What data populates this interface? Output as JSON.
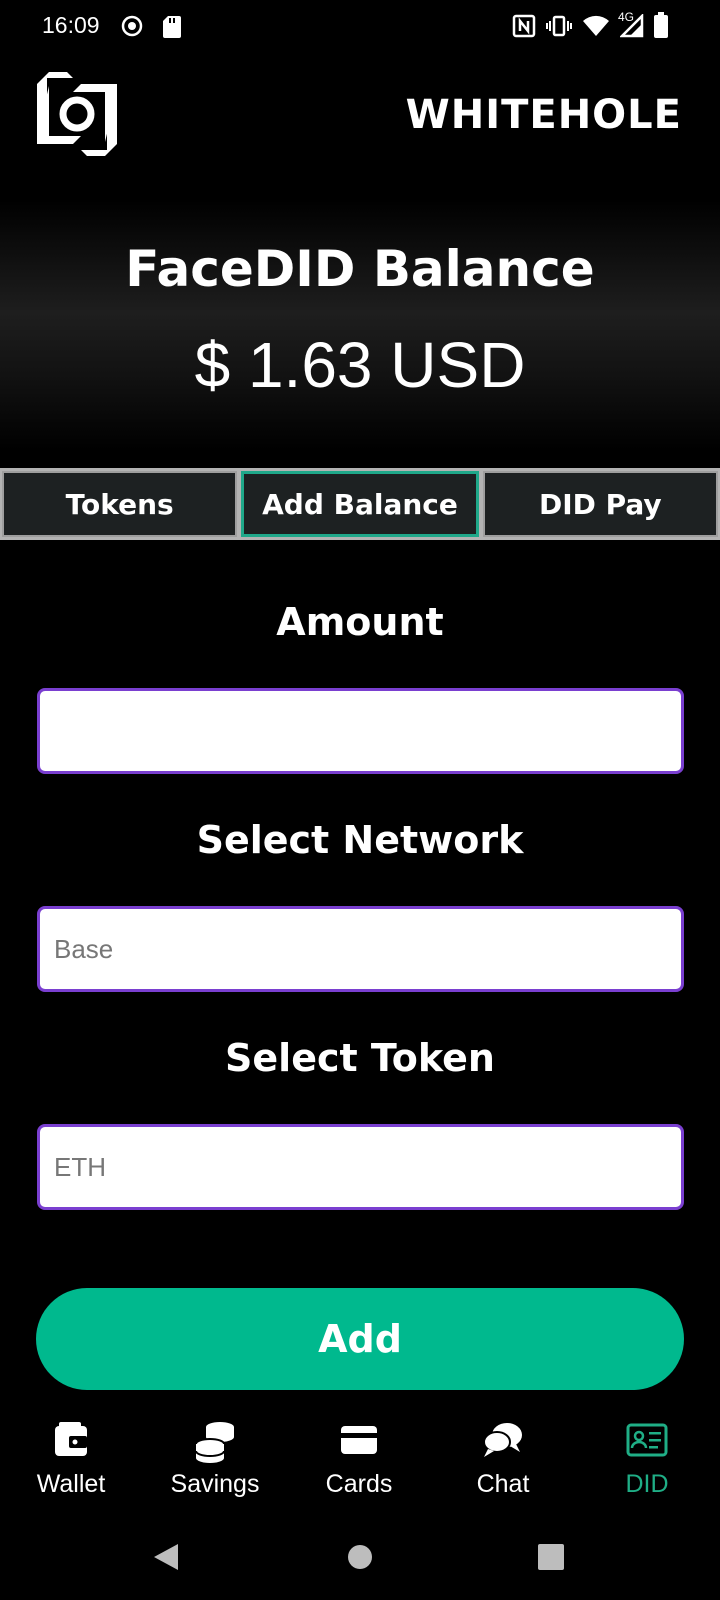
{
  "status_bar": {
    "time": "16:09",
    "network_label": "4G",
    "icons": [
      "screen-record-icon",
      "sd-card-icon",
      "nfc-icon",
      "vibrate-icon",
      "wifi-icon",
      "signal-icon",
      "battery-icon"
    ]
  },
  "header": {
    "brand": "WHITEHOLE",
    "logo_icon": "whitehole-logo-icon"
  },
  "balance": {
    "title": "FaceDID Balance",
    "value": "$ 1.63 USD"
  },
  "tabs": [
    {
      "label": "Tokens",
      "active": false
    },
    {
      "label": "Add Balance",
      "active": true
    },
    {
      "label": "DID Pay",
      "active": false
    }
  ],
  "form": {
    "amount_label": "Amount",
    "amount_value": "",
    "network_label": "Select Network",
    "network_value": "Base",
    "token_label": "Select Token",
    "token_value": "ETH",
    "submit_label": "Add"
  },
  "bottom_nav": [
    {
      "label": "Wallet",
      "icon": "wallet-icon",
      "active": false
    },
    {
      "label": "Savings",
      "icon": "coins-icon",
      "active": false
    },
    {
      "label": "Cards",
      "icon": "card-icon",
      "active": false
    },
    {
      "label": "Chat",
      "icon": "chat-icon",
      "active": false
    },
    {
      "label": "DID",
      "icon": "id-card-icon",
      "active": true
    }
  ],
  "colors": {
    "accent": "#00b98e",
    "field_border": "#7a3fd0",
    "active_tab_border": "#1fa88a",
    "active_nav": "#1fae86"
  }
}
